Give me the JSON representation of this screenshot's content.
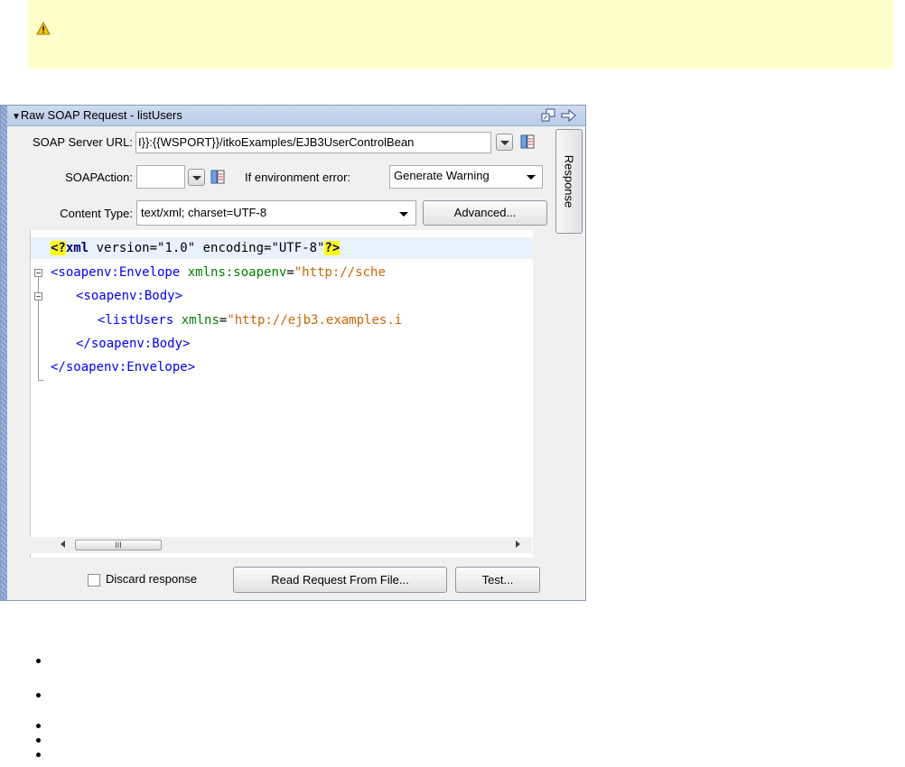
{
  "banner": {
    "icon": "warning-icon"
  },
  "panel": {
    "title": "Raw SOAP Request - listUsers",
    "icons": [
      "detach-icon",
      "arrow-right-icon"
    ],
    "soap_server_url": {
      "label": "SOAP Server URL:",
      "value": "I}}:{{WSPORT}}/itkoExamples/EJB3UserControlBean"
    },
    "soap_action": {
      "label": "SOAPAction:",
      "value": ""
    },
    "env_error": {
      "label": "If environment error:",
      "value": "Generate Warning"
    },
    "content_type": {
      "label": "Content Type:",
      "value": "text/xml; charset=UTF-8"
    },
    "advanced_label": "Advanced...",
    "response_tab": "Response",
    "discard_label": "Discard response",
    "read_request_label": "Read Request From File...",
    "test_label": "Test...",
    "scroll_thumb": "III"
  },
  "code": {
    "l1": {
      "open": "<?",
      "name": "xml",
      "rest": " version=\"1.0\" encoding=\"UTF-8\"",
      "close": "?>"
    },
    "l2": {
      "tag": "<soapenv:Envelope",
      "attr": " xmlns:soapenv",
      "eq": "=",
      "str": "\"http://sche"
    },
    "l3": {
      "tag": "<soapenv:Body>"
    },
    "l4": {
      "tag": "<listUsers",
      "attr": " xmlns",
      "eq": "=",
      "str": "\"http://ejb3.examples.i"
    },
    "l5": {
      "tag": "</soapenv:Body>"
    },
    "l6": {
      "tag": "</soapenv:Envelope>"
    }
  },
  "bullets_count": 5
}
